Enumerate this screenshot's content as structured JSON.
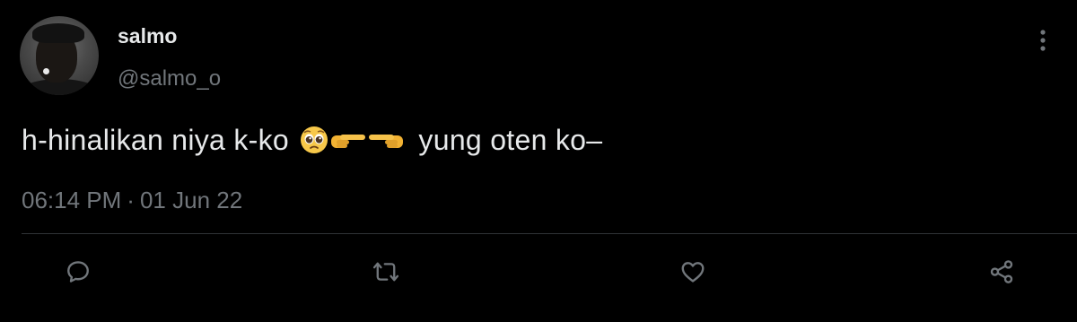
{
  "tweet": {
    "display_name": "salmo",
    "handle": "@salmo_o",
    "text_before": "h-hinalikan niya k-ko",
    "emojis": [
      "pleading-face",
      "backhand-index-pointing-right",
      "backhand-index-pointing-left"
    ],
    "text_after": "yung oten ko–",
    "time": "06:14 PM",
    "separator": "·",
    "date": "01 Jun 22"
  },
  "actions": [
    {
      "name": "reply",
      "icon": "reply-icon"
    },
    {
      "name": "retweet",
      "icon": "retweet-icon"
    },
    {
      "name": "like",
      "icon": "heart-icon"
    },
    {
      "name": "share",
      "icon": "share-icon"
    }
  ],
  "colors": {
    "background": "#000000",
    "primary_text": "#e7e9ea",
    "secondary_text": "#71767b",
    "divider": "#2f3336"
  }
}
